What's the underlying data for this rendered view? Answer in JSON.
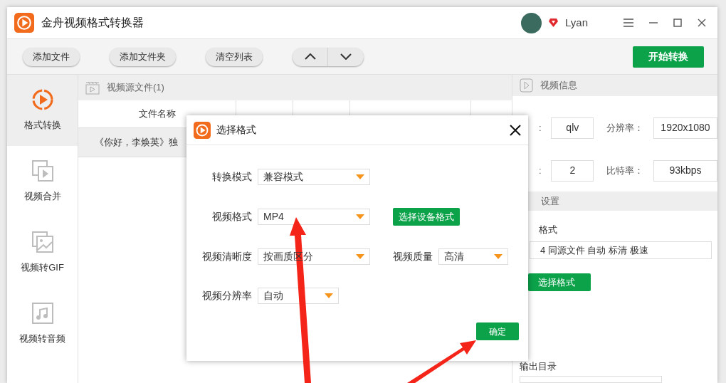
{
  "window": {
    "title": "金舟视频格式转换器",
    "user": "Lyan"
  },
  "toolbar": {
    "buttons": [
      "添加文件",
      "添加文件夹",
      "清空列表"
    ],
    "start_button": "开始转换"
  },
  "sidebar": {
    "items": [
      {
        "label": "格式转换",
        "selected": true,
        "kind": "convert"
      },
      {
        "label": "视频合并",
        "selected": false,
        "kind": "merge"
      },
      {
        "label": "视频转GIF",
        "selected": false,
        "kind": "gif"
      },
      {
        "label": "视频转音频",
        "selected": false,
        "kind": "audio"
      }
    ]
  },
  "file_list": {
    "title": "视频源文件(1)",
    "columns": [
      "文件名称"
    ],
    "rows": [
      {
        "name": "《你好，李焕英》独",
        "selected": true
      }
    ]
  },
  "video_info": {
    "title": "视频信息",
    "fields": [
      {
        "label": ":",
        "value": "qlv"
      },
      {
        "label": "分辨率：",
        "value": "1920x1080"
      },
      {
        "label": ":",
        "value": "2"
      },
      {
        "label": "比特率：",
        "value": "93kbps"
      }
    ]
  },
  "output_settings": {
    "title": "设置",
    "format_label": "格式",
    "format_value": "4 同源文件 自动 标清 极速",
    "format_button": "选择格式",
    "dir_label": "输出目录"
  },
  "dialog": {
    "title": "选择格式",
    "rows": [
      [
        {
          "kind": "select",
          "label": "转换模式",
          "value": "兼容模式"
        }
      ],
      [
        {
          "kind": "select",
          "label": "视频格式",
          "value": "MP4"
        },
        {
          "kind": "button",
          "label": "选择设备格式"
        }
      ],
      [
        {
          "kind": "select",
          "label": "视频清晰度",
          "value": "按画质区分"
        },
        {
          "kind": "select",
          "label": "视频质量",
          "value": "高清"
        }
      ],
      [
        {
          "kind": "small_select",
          "label": "视频分辨率",
          "value": "自动"
        }
      ]
    ],
    "confirm": "确定"
  }
}
